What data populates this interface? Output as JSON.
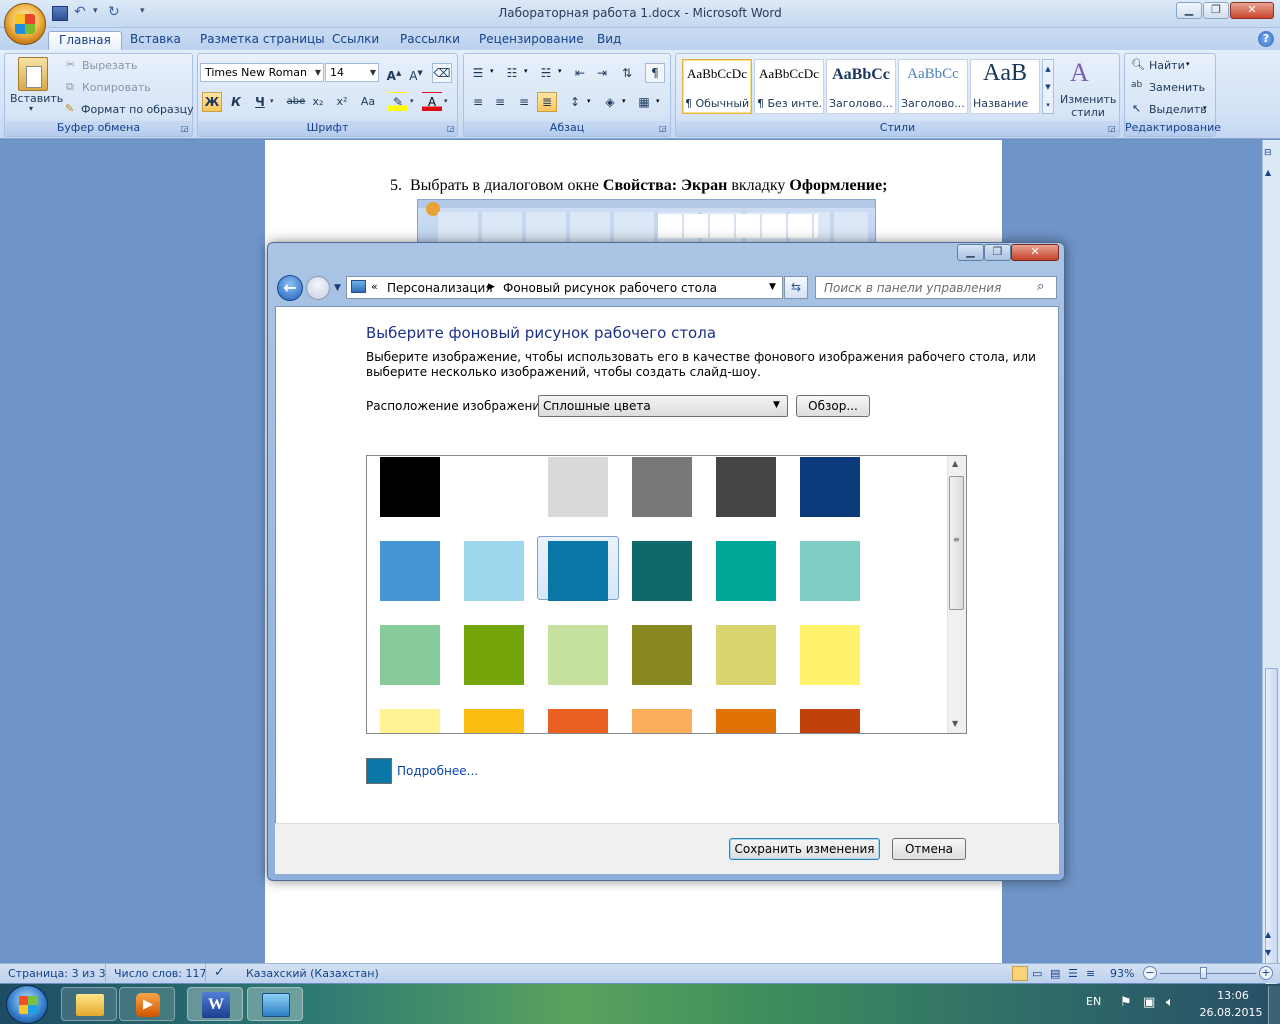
{
  "window": {
    "title": "Лабораторная работа 1.docx - Microsoft Word"
  },
  "ribbon_tabs": [
    "Главная",
    "Вставка",
    "Разметка страницы",
    "Ссылки",
    "Рассылки",
    "Рецензирование",
    "Вид"
  ],
  "clipboard": {
    "paste": "Вставить",
    "cut": "Вырезать",
    "copy": "Копировать",
    "format_painter": "Формат по образцу",
    "label": "Буфер обмена"
  },
  "font": {
    "name": "Times New Roman",
    "size": "14",
    "label": "Шрифт",
    "bold": "Ж",
    "italic": "К",
    "underline": "Ч",
    "strike": "abe",
    "sub": "x₂",
    "sup": "x²",
    "case": "Aa"
  },
  "paragraph": {
    "label": "Абзац"
  },
  "styles": {
    "label": "Стили",
    "items": [
      {
        "preview": "AaBbCcDc",
        "name": "¶ Обычный"
      },
      {
        "preview": "AaBbCcDc",
        "name": "¶ Без инте..."
      },
      {
        "preview": "AaBbCc",
        "name": "Заголово..."
      },
      {
        "preview": "AaBbCc",
        "name": "Заголово..."
      },
      {
        "preview": "AaB",
        "name": "Название"
      }
    ],
    "change": "Изменить стили"
  },
  "editing": {
    "find": "Найти",
    "replace": "Заменить",
    "select": "Выделить",
    "label": "Редактирование"
  },
  "document": {
    "line_number": "5.",
    "line_text_1": "Выбрать в диалоговом окне ",
    "line_bold_1": "Свойства: Экран",
    "line_text_2": " вкладку ",
    "line_bold_2": "Оформление;"
  },
  "dialog": {
    "breadcrumb_1": "Персонализация",
    "breadcrumb_2": "Фоновый рисунок рабочего стола",
    "search_placeholder": "Поиск в панели управления",
    "heading": "Выберите фоновый рисунок рабочего стола",
    "desc_1": "Выберите изображение, чтобы использовать его в качестве фонового изображения рабочего стола, или",
    "desc_2": "выберите несколько изображений, чтобы создать слайд-шоу.",
    "location_label": "Расположение изображения:",
    "location_value": "Сплошные цвета",
    "browse": "Обзор...",
    "more": "Подробнее...",
    "save": "Сохранить изменения",
    "cancel": "Отмена",
    "selected_color": "#0a76a6",
    "colors": [
      [
        "#000000",
        "#ffffff",
        "#d9d9d9",
        "#787878",
        "#454545",
        "#0b3b7a"
      ],
      [
        "#4594d6",
        "#9ed8ec",
        "#0a76a6",
        "#0e6a6a",
        "#00a89a",
        "#7fcdc4"
      ],
      [
        "#87cb9b",
        "#73a50b",
        "#c6e09d",
        "#878920",
        "#dad56f",
        "#fef36a"
      ],
      [
        "#fff394",
        "#fcbd12",
        "#ea6022",
        "#fcad5c",
        "#e17306",
        "#c1410b"
      ]
    ]
  },
  "status": {
    "page": "Страница: 3 из 3",
    "words": "Число слов: 117",
    "language": "Казахский (Казахстан)",
    "zoom": "93%"
  },
  "tray": {
    "lang": "EN",
    "time": "13:06",
    "date": "26.08.2015"
  }
}
